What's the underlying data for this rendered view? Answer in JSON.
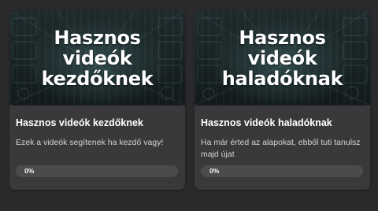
{
  "courses": [
    {
      "thumbnail_lines": [
        "Hasznos",
        "videók",
        "kezdőknek"
      ],
      "title": "Hasznos videók kezdőknek",
      "description": "Ezek a videók segítenek ha kezdő vagy!",
      "progress_label": "0%",
      "progress": 0
    },
    {
      "thumbnail_lines": [
        "Hasznos",
        "videók",
        "haladóknak"
      ],
      "title": "Hasznos videók haladóknak",
      "description": "Ha már érted az alapokat, ebből tuti tanulsz majd újat",
      "progress_label": "0%",
      "progress": 0
    }
  ],
  "colors": {
    "background": "#2a2a2c",
    "card": "#39393b",
    "progress_track": "#4b4b4e"
  }
}
